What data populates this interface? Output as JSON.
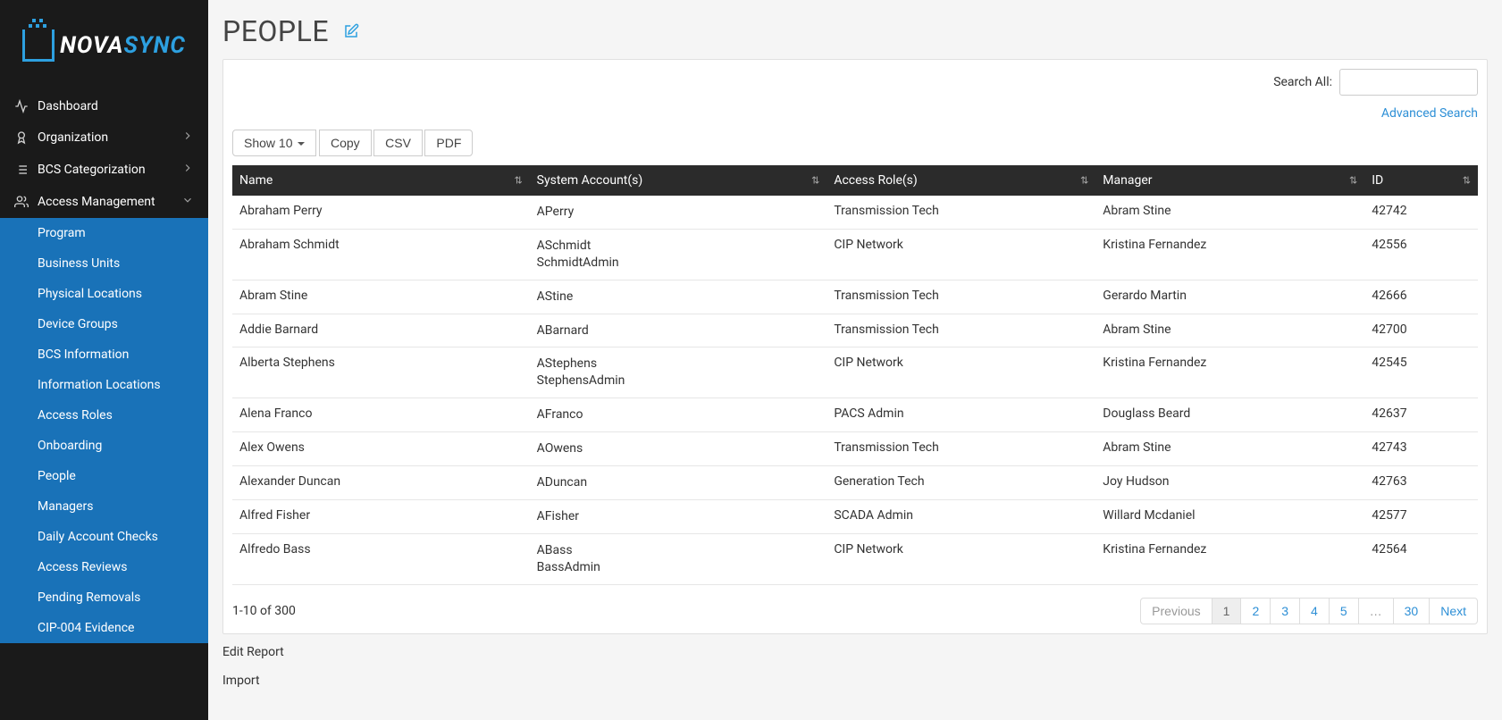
{
  "brand": {
    "part1": "NOVA",
    "part2": "SYNC"
  },
  "sidebar": {
    "items": [
      {
        "label": "Dashboard",
        "icon": "activity",
        "expandable": false
      },
      {
        "label": "Organization",
        "icon": "badge",
        "expandable": true
      },
      {
        "label": "BCS Categorization",
        "icon": "list",
        "expandable": true
      },
      {
        "label": "Access Management",
        "icon": "users",
        "expandable": true,
        "open": true,
        "children": [
          "Program",
          "Business Units",
          "Physical Locations",
          "Device Groups",
          "BCS Information",
          "Information Locations",
          "Access Roles",
          "Onboarding",
          "People",
          "Managers",
          "Daily Account Checks",
          "Access Reviews",
          "Pending Removals",
          "CIP-004 Evidence"
        ]
      }
    ]
  },
  "page": {
    "title": "PEOPLE",
    "search_label": "Search All:",
    "search_placeholder": "",
    "advanced_search": "Advanced Search"
  },
  "toolbar": {
    "show_label": "Show 10",
    "copy": "Copy",
    "csv": "CSV",
    "pdf": "PDF"
  },
  "table": {
    "columns": [
      "Name",
      "System Account(s)",
      "Access Role(s)",
      "Manager",
      "ID"
    ],
    "rows": [
      {
        "name": "Abraham Perry",
        "accounts": [
          "APerry"
        ],
        "roles": "Transmission Tech",
        "manager": "Abram Stine",
        "id": "42742"
      },
      {
        "name": "Abraham Schmidt",
        "accounts": [
          "ASchmidt",
          "SchmidtAdmin"
        ],
        "roles": "CIP Network",
        "manager": "Kristina Fernandez",
        "id": "42556"
      },
      {
        "name": "Abram Stine",
        "accounts": [
          "AStine"
        ],
        "roles": "Transmission Tech",
        "manager": "Gerardo Martin",
        "id": "42666"
      },
      {
        "name": "Addie Barnard",
        "accounts": [
          "ABarnard"
        ],
        "roles": "Transmission Tech",
        "manager": "Abram Stine",
        "id": "42700"
      },
      {
        "name": "Alberta Stephens",
        "accounts": [
          "AStephens",
          "StephensAdmin"
        ],
        "roles": "CIP Network",
        "manager": "Kristina Fernandez",
        "id": "42545"
      },
      {
        "name": "Alena Franco",
        "accounts": [
          "AFranco"
        ],
        "roles": "PACS Admin",
        "manager": "Douglass Beard",
        "id": "42637"
      },
      {
        "name": "Alex Owens",
        "accounts": [
          "AOwens"
        ],
        "roles": "Transmission Tech",
        "manager": "Abram Stine",
        "id": "42743"
      },
      {
        "name": "Alexander Duncan",
        "accounts": [
          "ADuncan"
        ],
        "roles": "Generation Tech",
        "manager": "Joy Hudson",
        "id": "42763"
      },
      {
        "name": "Alfred Fisher",
        "accounts": [
          "AFisher"
        ],
        "roles": "SCADA Admin",
        "manager": "Willard Mcdaniel",
        "id": "42577"
      },
      {
        "name": "Alfredo Bass",
        "accounts": [
          "ABass",
          "BassAdmin"
        ],
        "roles": "CIP Network",
        "manager": "Kristina Fernandez",
        "id": "42564"
      }
    ],
    "range_text": "1-10 of 300"
  },
  "pagination": {
    "previous": "Previous",
    "next": "Next",
    "pages": [
      "1",
      "2",
      "3",
      "4",
      "5",
      "…",
      "30"
    ],
    "active": "1"
  },
  "footer_links": {
    "edit_report": "Edit Report",
    "import": "Import"
  }
}
